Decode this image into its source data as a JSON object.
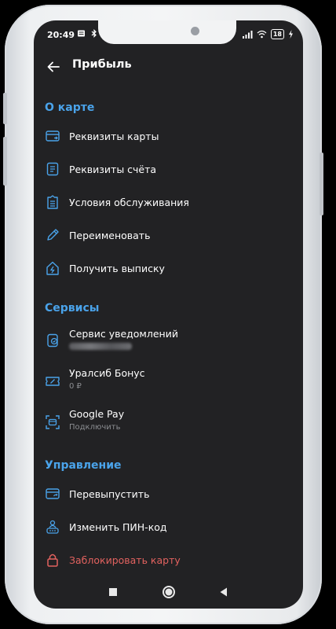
{
  "status_bar": {
    "time": "20:49",
    "battery": "18"
  },
  "header": {
    "title": "Прибыль"
  },
  "sections": [
    {
      "title": "О карте",
      "items": [
        {
          "label": "Реквизиты карты",
          "icon": "card-details-icon"
        },
        {
          "label": "Реквизиты счёта",
          "icon": "document-icon"
        },
        {
          "label": "Условия обслуживания",
          "icon": "clipboard-icon"
        },
        {
          "label": "Переименовать",
          "icon": "pencil-icon"
        },
        {
          "label": "Получить выписку",
          "icon": "statement-icon"
        }
      ]
    },
    {
      "title": "Сервисы",
      "items": [
        {
          "label": "Сервис уведомлений",
          "icon": "notification-icon"
        },
        {
          "label": "Уралсиб Бонус",
          "sub": "0 ₽",
          "icon": "bonus-ticket-icon"
        },
        {
          "label": "Google Pay",
          "sub": "Подключить",
          "icon": "google-pay-icon"
        }
      ]
    },
    {
      "title": "Управление",
      "items": [
        {
          "label": "Перевыпустить",
          "icon": "card-reissue-icon"
        },
        {
          "label": "Изменить ПИН-код",
          "icon": "pin-code-icon"
        },
        {
          "label": "Заблокировать карту",
          "icon": "lock-icon"
        }
      ]
    }
  ],
  "colors": {
    "accent": "#4aa3ea",
    "danger": "#e2625f",
    "background": "#222224"
  }
}
